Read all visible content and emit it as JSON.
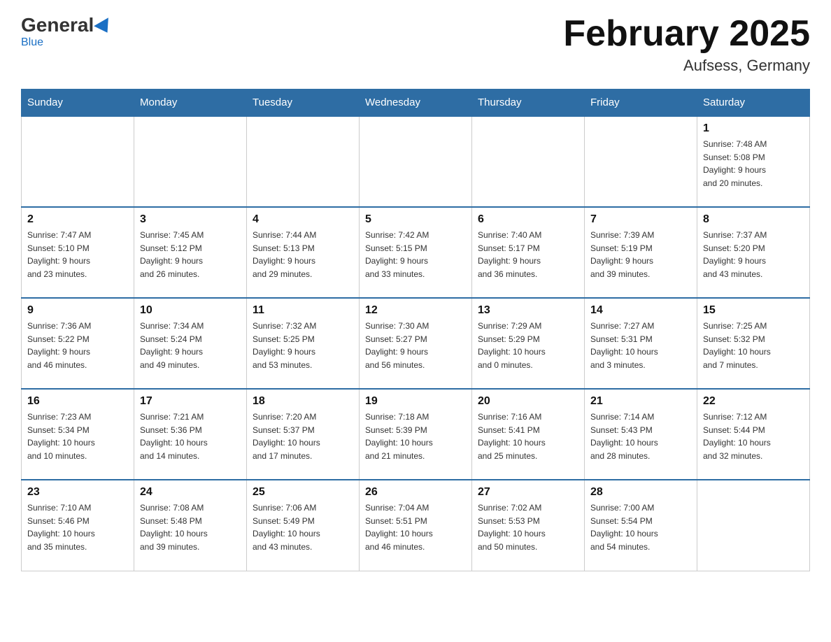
{
  "header": {
    "logo_general": "General",
    "logo_blue": "Blue",
    "month_title": "February 2025",
    "location": "Aufsess, Germany"
  },
  "weekdays": [
    "Sunday",
    "Monday",
    "Tuesday",
    "Wednesday",
    "Thursday",
    "Friday",
    "Saturday"
  ],
  "weeks": [
    [
      {
        "day": "",
        "info": ""
      },
      {
        "day": "",
        "info": ""
      },
      {
        "day": "",
        "info": ""
      },
      {
        "day": "",
        "info": ""
      },
      {
        "day": "",
        "info": ""
      },
      {
        "day": "",
        "info": ""
      },
      {
        "day": "1",
        "info": "Sunrise: 7:48 AM\nSunset: 5:08 PM\nDaylight: 9 hours\nand 20 minutes."
      }
    ],
    [
      {
        "day": "2",
        "info": "Sunrise: 7:47 AM\nSunset: 5:10 PM\nDaylight: 9 hours\nand 23 minutes."
      },
      {
        "day": "3",
        "info": "Sunrise: 7:45 AM\nSunset: 5:12 PM\nDaylight: 9 hours\nand 26 minutes."
      },
      {
        "day": "4",
        "info": "Sunrise: 7:44 AM\nSunset: 5:13 PM\nDaylight: 9 hours\nand 29 minutes."
      },
      {
        "day": "5",
        "info": "Sunrise: 7:42 AM\nSunset: 5:15 PM\nDaylight: 9 hours\nand 33 minutes."
      },
      {
        "day": "6",
        "info": "Sunrise: 7:40 AM\nSunset: 5:17 PM\nDaylight: 9 hours\nand 36 minutes."
      },
      {
        "day": "7",
        "info": "Sunrise: 7:39 AM\nSunset: 5:19 PM\nDaylight: 9 hours\nand 39 minutes."
      },
      {
        "day": "8",
        "info": "Sunrise: 7:37 AM\nSunset: 5:20 PM\nDaylight: 9 hours\nand 43 minutes."
      }
    ],
    [
      {
        "day": "9",
        "info": "Sunrise: 7:36 AM\nSunset: 5:22 PM\nDaylight: 9 hours\nand 46 minutes."
      },
      {
        "day": "10",
        "info": "Sunrise: 7:34 AM\nSunset: 5:24 PM\nDaylight: 9 hours\nand 49 minutes."
      },
      {
        "day": "11",
        "info": "Sunrise: 7:32 AM\nSunset: 5:25 PM\nDaylight: 9 hours\nand 53 minutes."
      },
      {
        "day": "12",
        "info": "Sunrise: 7:30 AM\nSunset: 5:27 PM\nDaylight: 9 hours\nand 56 minutes."
      },
      {
        "day": "13",
        "info": "Sunrise: 7:29 AM\nSunset: 5:29 PM\nDaylight: 10 hours\nand 0 minutes."
      },
      {
        "day": "14",
        "info": "Sunrise: 7:27 AM\nSunset: 5:31 PM\nDaylight: 10 hours\nand 3 minutes."
      },
      {
        "day": "15",
        "info": "Sunrise: 7:25 AM\nSunset: 5:32 PM\nDaylight: 10 hours\nand 7 minutes."
      }
    ],
    [
      {
        "day": "16",
        "info": "Sunrise: 7:23 AM\nSunset: 5:34 PM\nDaylight: 10 hours\nand 10 minutes."
      },
      {
        "day": "17",
        "info": "Sunrise: 7:21 AM\nSunset: 5:36 PM\nDaylight: 10 hours\nand 14 minutes."
      },
      {
        "day": "18",
        "info": "Sunrise: 7:20 AM\nSunset: 5:37 PM\nDaylight: 10 hours\nand 17 minutes."
      },
      {
        "day": "19",
        "info": "Sunrise: 7:18 AM\nSunset: 5:39 PM\nDaylight: 10 hours\nand 21 minutes."
      },
      {
        "day": "20",
        "info": "Sunrise: 7:16 AM\nSunset: 5:41 PM\nDaylight: 10 hours\nand 25 minutes."
      },
      {
        "day": "21",
        "info": "Sunrise: 7:14 AM\nSunset: 5:43 PM\nDaylight: 10 hours\nand 28 minutes."
      },
      {
        "day": "22",
        "info": "Sunrise: 7:12 AM\nSunset: 5:44 PM\nDaylight: 10 hours\nand 32 minutes."
      }
    ],
    [
      {
        "day": "23",
        "info": "Sunrise: 7:10 AM\nSunset: 5:46 PM\nDaylight: 10 hours\nand 35 minutes."
      },
      {
        "day": "24",
        "info": "Sunrise: 7:08 AM\nSunset: 5:48 PM\nDaylight: 10 hours\nand 39 minutes."
      },
      {
        "day": "25",
        "info": "Sunrise: 7:06 AM\nSunset: 5:49 PM\nDaylight: 10 hours\nand 43 minutes."
      },
      {
        "day": "26",
        "info": "Sunrise: 7:04 AM\nSunset: 5:51 PM\nDaylight: 10 hours\nand 46 minutes."
      },
      {
        "day": "27",
        "info": "Sunrise: 7:02 AM\nSunset: 5:53 PM\nDaylight: 10 hours\nand 50 minutes."
      },
      {
        "day": "28",
        "info": "Sunrise: 7:00 AM\nSunset: 5:54 PM\nDaylight: 10 hours\nand 54 minutes."
      },
      {
        "day": "",
        "info": ""
      }
    ]
  ]
}
